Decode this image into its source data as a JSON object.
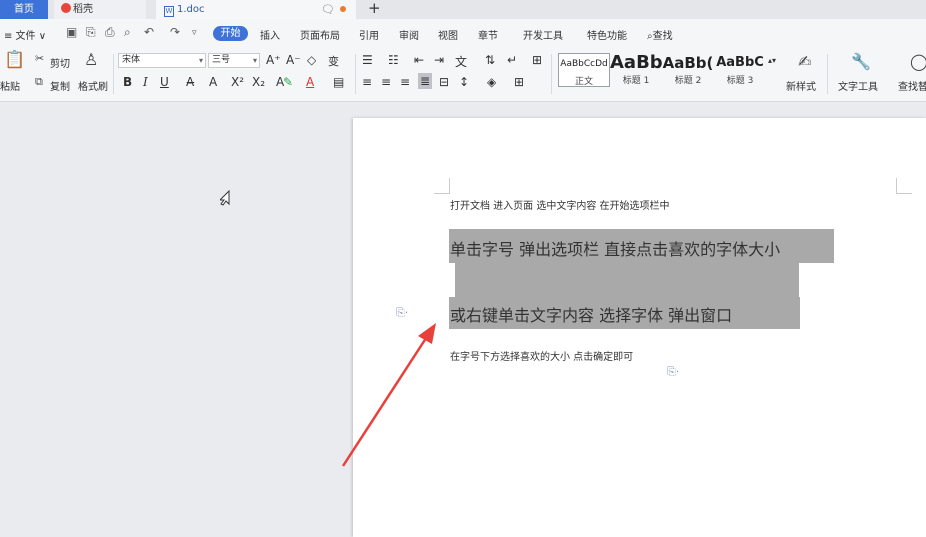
{
  "tabs": {
    "home": "首页",
    "daoke": "稻壳",
    "doc": "1.doc",
    "new_tab": "+"
  },
  "menu": {
    "file": "≡ 文件 ∨",
    "start": "开始",
    "items": [
      "插入",
      "页面布局",
      "引用",
      "审阅",
      "视图",
      "章节",
      "开发工具",
      "特色功能"
    ],
    "search": "查找"
  },
  "ribbon": {
    "paste": "粘贴",
    "cut": "剪切",
    "copy": "复制",
    "format_painter": "格式刷",
    "font_name": "宋体",
    "font_size": "三号",
    "bold": "B",
    "italic": "I",
    "underline": "U",
    "styles": [
      {
        "sample": "AaBbCcDd",
        "name": "正文"
      },
      {
        "sample": "AaBb",
        "name": "标题 1"
      },
      {
        "sample": "AaBb(",
        "name": "标题 2"
      },
      {
        "sample": "AaBbC",
        "name": "标题 3"
      }
    ],
    "new_style": "新样式",
    "text_tools": "文字工具",
    "find_replace": "查找替"
  },
  "document": {
    "line1": "打开文档    进入页面    选中文字内容    在开始选项栏中",
    "line2": "单击字号    弹出选项栏    直接点击喜欢的字体大小",
    "line3": "或右键单击文字内容    选择字体    弹出窗口",
    "line4": "在字号下方选择喜欢的大小    点击确定即可"
  },
  "colors": {
    "accent": "#3e72d8",
    "highlight": "#a9a9a9",
    "arrow": "#e8403a"
  }
}
